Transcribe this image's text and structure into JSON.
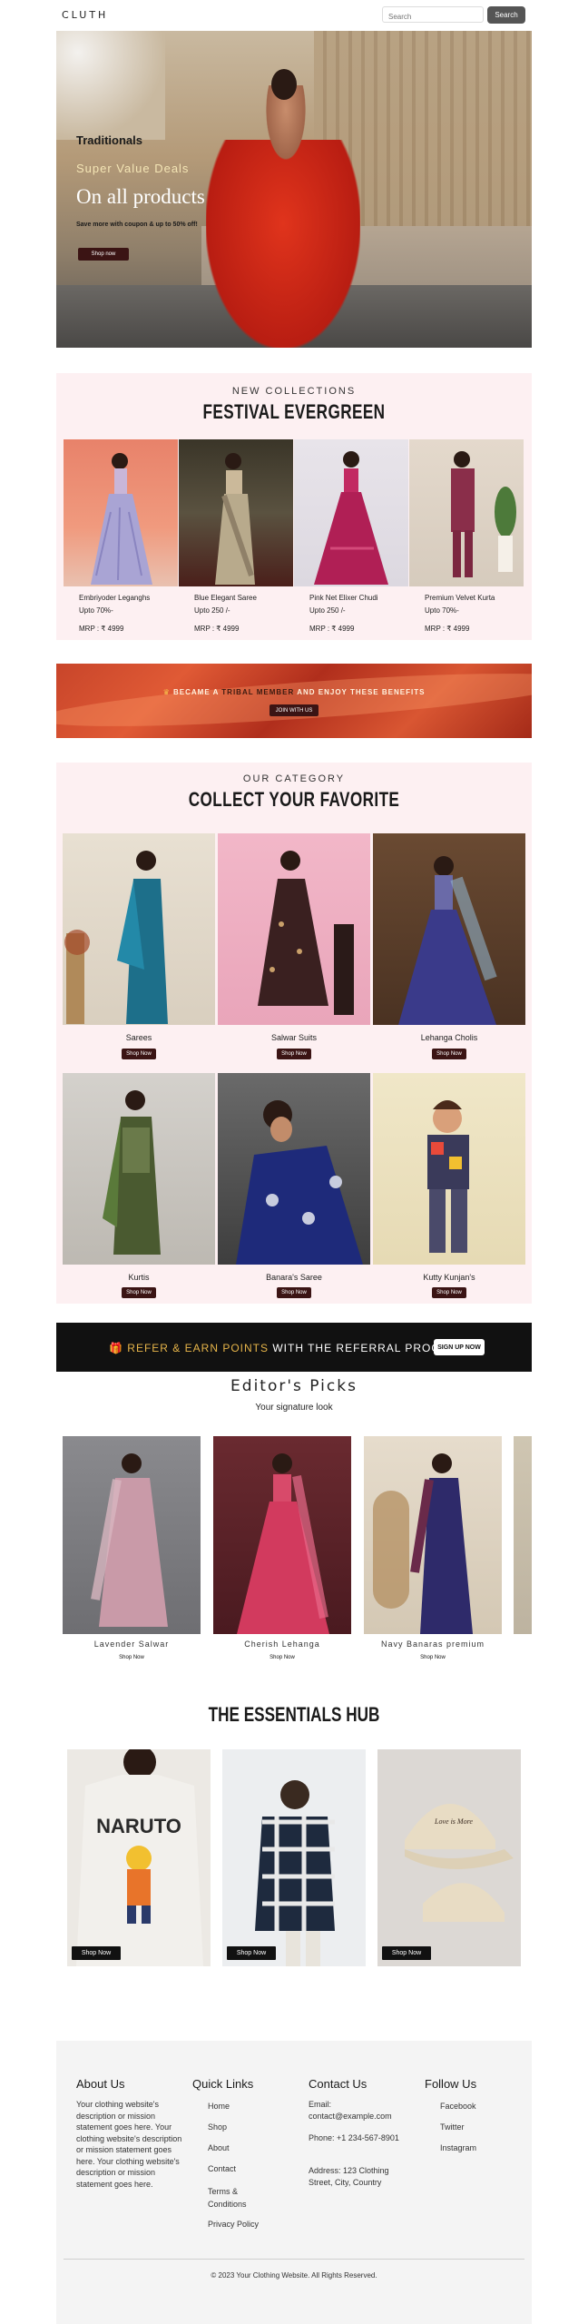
{
  "header": {
    "logo": "CLUTH",
    "search_placeholder": "Search",
    "search_button": "Search"
  },
  "hero": {
    "line1": "Traditionals",
    "line2": "Super Value Deals",
    "line3": "On all products",
    "line4": "Save more with coupon & up to 50% off!",
    "button": "Shop now"
  },
  "collections": {
    "kicker": "NEW COLLECTIONS",
    "title": "FESTIVAL EVERGREEN",
    "products": [
      {
        "name": "Embriyoder Leganghs",
        "discount": "Upto 70%-",
        "price": "MRP : ₹ 4999"
      },
      {
        "name": "Blue Elegant Saree",
        "discount": "Upto 250 /-",
        "price": "MRP : ₹ 4999"
      },
      {
        "name": "Pink Net Elixer Chudi",
        "discount": "Upto 250 /-",
        "price": "MRP : ₹ 4999"
      },
      {
        "name": "Premium Velvet Kurta",
        "discount": "Upto 70%-",
        "price": "MRP : ₹ 4999"
      }
    ]
  },
  "tribal_banner": {
    "prefix": "BECAME A",
    "highlight": "TRIBAL MEMBER",
    "suffix": "AND ENJOY THESE BENEFITS",
    "button": "JOIN WITH US"
  },
  "category": {
    "kicker": "OUR CATEGORY",
    "title": "COLLECT YOUR FAVORITE",
    "button": "Shop Now",
    "items": [
      {
        "label": "Sarees"
      },
      {
        "label": "Salwar Suits"
      },
      {
        "label": "Lehanga Cholis"
      },
      {
        "label": "Kurtis"
      },
      {
        "label": "Banara's Saree"
      },
      {
        "label": "Kutty Kunjan's"
      }
    ]
  },
  "referral": {
    "gold_text": "REFER & EARN POINTS",
    "text": "WITH THE REFERRAL PROGRAM",
    "button": "SIGN UP NOW"
  },
  "editors_picks": {
    "title": "Editor's Picks",
    "subtitle": "Your signature look",
    "shop_label": "Shop Now",
    "items": [
      {
        "name": "Lavender Salwar"
      },
      {
        "name": "Cherish Lehanga"
      },
      {
        "name": "Navy Banaras premium"
      }
    ]
  },
  "essentials": {
    "title": "THE ESSENTIALS HUB",
    "button": "Shop Now",
    "tee_text_top": "NARUTO",
    "cap_text": "Love is More"
  },
  "footer": {
    "about": {
      "title": "About Us",
      "text": "Your clothing website's description or mission statement goes here. Your clothing website's description or mission statement goes here. Your clothing website's description or mission statement goes here."
    },
    "quick_links": {
      "title": "Quick Links",
      "links": [
        "Home",
        "Shop",
        "About",
        "Contact",
        "Terms & Conditions",
        "Privacy Policy"
      ]
    },
    "contact": {
      "title": "Contact Us",
      "email": "Email: contact@example.com",
      "phone": "Phone: +1 234-567-8901",
      "address": "Address: 123 Clothing Street, City, Country"
    },
    "follow": {
      "title": "Follow Us",
      "links": [
        "Facebook",
        "Twitter",
        "Instagram"
      ]
    },
    "copyright": "© 2023 Your Clothing Website. All Rights Reserved."
  },
  "colors": {
    "dark_button": "#3b1414",
    "pink_section": "#fdf0f2",
    "referral_bg": "#111111",
    "gold": "#e7b54a",
    "footer_bg": "#f4f4f4"
  },
  "icons": {
    "referral_icon": "gift-icon"
  }
}
